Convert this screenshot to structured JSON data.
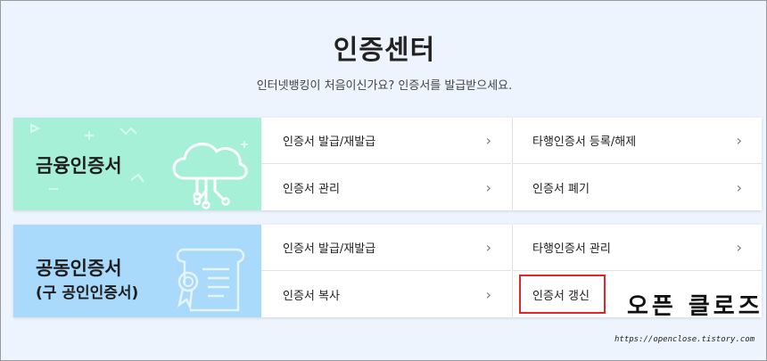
{
  "page": {
    "title": "인증센터",
    "subtitle": "인터넷뱅킹이 처음이신가요? 인증서를 발급받으세요."
  },
  "financial": {
    "title": "금융인증서",
    "menu": [
      {
        "label": "인증서 발급/재발급"
      },
      {
        "label": "타행인증서 등록/해제"
      },
      {
        "label": "인증서 관리"
      },
      {
        "label": "인증서 폐기"
      }
    ]
  },
  "joint": {
    "title": "공동인증서",
    "subtitle": "(구 공인인증서)",
    "menu": [
      {
        "label": "인증서 발급/재발급"
      },
      {
        "label": "타행인증서 관리"
      },
      {
        "label": "인증서 복사"
      },
      {
        "label": "인증서 갱신"
      }
    ]
  },
  "chevron": "›",
  "watermark": {
    "text": "오픈 클로즈",
    "url": "https://openclose.tistory.com"
  },
  "colors": {
    "financial_banner": "#a6f0d8",
    "joint_banner": "#a9d9fb",
    "highlight": "#e0262b",
    "background": "#eef4fd"
  },
  "icons": {
    "financial": "cloud-network-icon",
    "joint": "certificate-scroll-icon"
  }
}
